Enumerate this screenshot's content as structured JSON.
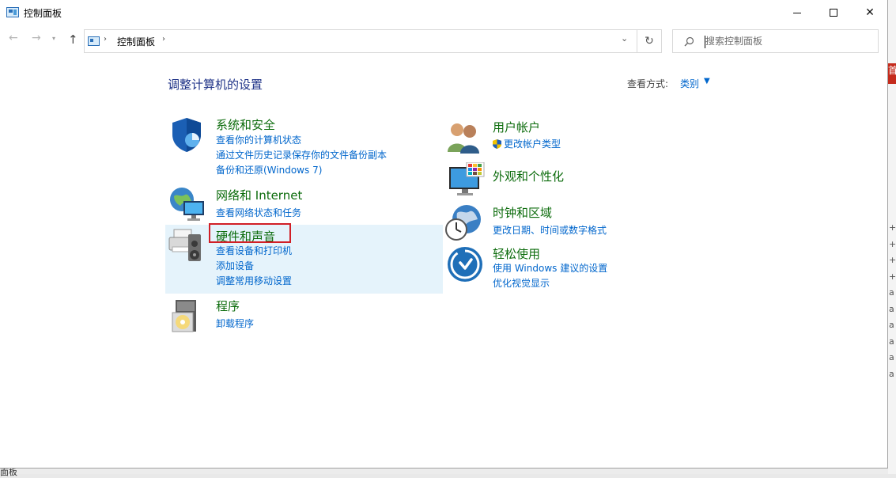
{
  "window": {
    "title": "控制面板"
  },
  "window_buttons": {
    "minimize": "—",
    "close": "✕"
  },
  "nav": {
    "back": "←",
    "forward": "→",
    "recent": "▾",
    "up": "↑"
  },
  "address": {
    "separator": "›",
    "location": "控制面板",
    "dropdown": "⌄",
    "refresh": "↻"
  },
  "search": {
    "placeholder": "搜索控制面板",
    "icon": "⚲"
  },
  "main": {
    "title": "调整计算机的设置",
    "view_by_label": "查看方式:",
    "view_by_value": "类别",
    "view_by_caret": "▼"
  },
  "categories_left": [
    {
      "title": "系统和安全",
      "icon": "shield-icon",
      "links": [
        "查看你的计算机状态",
        "通过文件历史记录保存你的文件备份副本",
        "备份和还原(Windows 7)"
      ]
    },
    {
      "title": "网络和 Internet",
      "icon": "network-globe-icon",
      "links": [
        "查看网络状态和任务"
      ]
    },
    {
      "title": "硬件和声音",
      "icon": "printer-speaker-icon",
      "links": [
        "查看设备和打印机",
        "添加设备",
        "调整常用移动设置"
      ]
    },
    {
      "title": "程序",
      "icon": "programs-disc-icon",
      "links": [
        "卸载程序"
      ]
    }
  ],
  "categories_right": [
    {
      "title": "用户帐户",
      "icon": "users-icon",
      "links": [
        "更改帐户类型"
      ]
    },
    {
      "title": "外观和个性化",
      "icon": "monitor-palette-icon",
      "links": []
    },
    {
      "title": "时钟和区域",
      "icon": "clock-globe-icon",
      "links": [
        "更改日期、时间或数字格式"
      ]
    },
    {
      "title": "轻松使用",
      "icon": "ease-of-access-icon",
      "links": [
        "使用 Windows 建议的设置",
        "优化视觉显示"
      ]
    }
  ],
  "background": {
    "red_tab_text": "首",
    "side_chars": "+\n+\n+\n+\na\na\na\na\na\na",
    "bottom_text": "面板"
  },
  "colors": {
    "link": "#0066cc",
    "category_title": "#0b6b0b",
    "page_title": "#1e3287",
    "highlight_border": "#d11f26",
    "hover_bg": "#e5f3fb"
  }
}
